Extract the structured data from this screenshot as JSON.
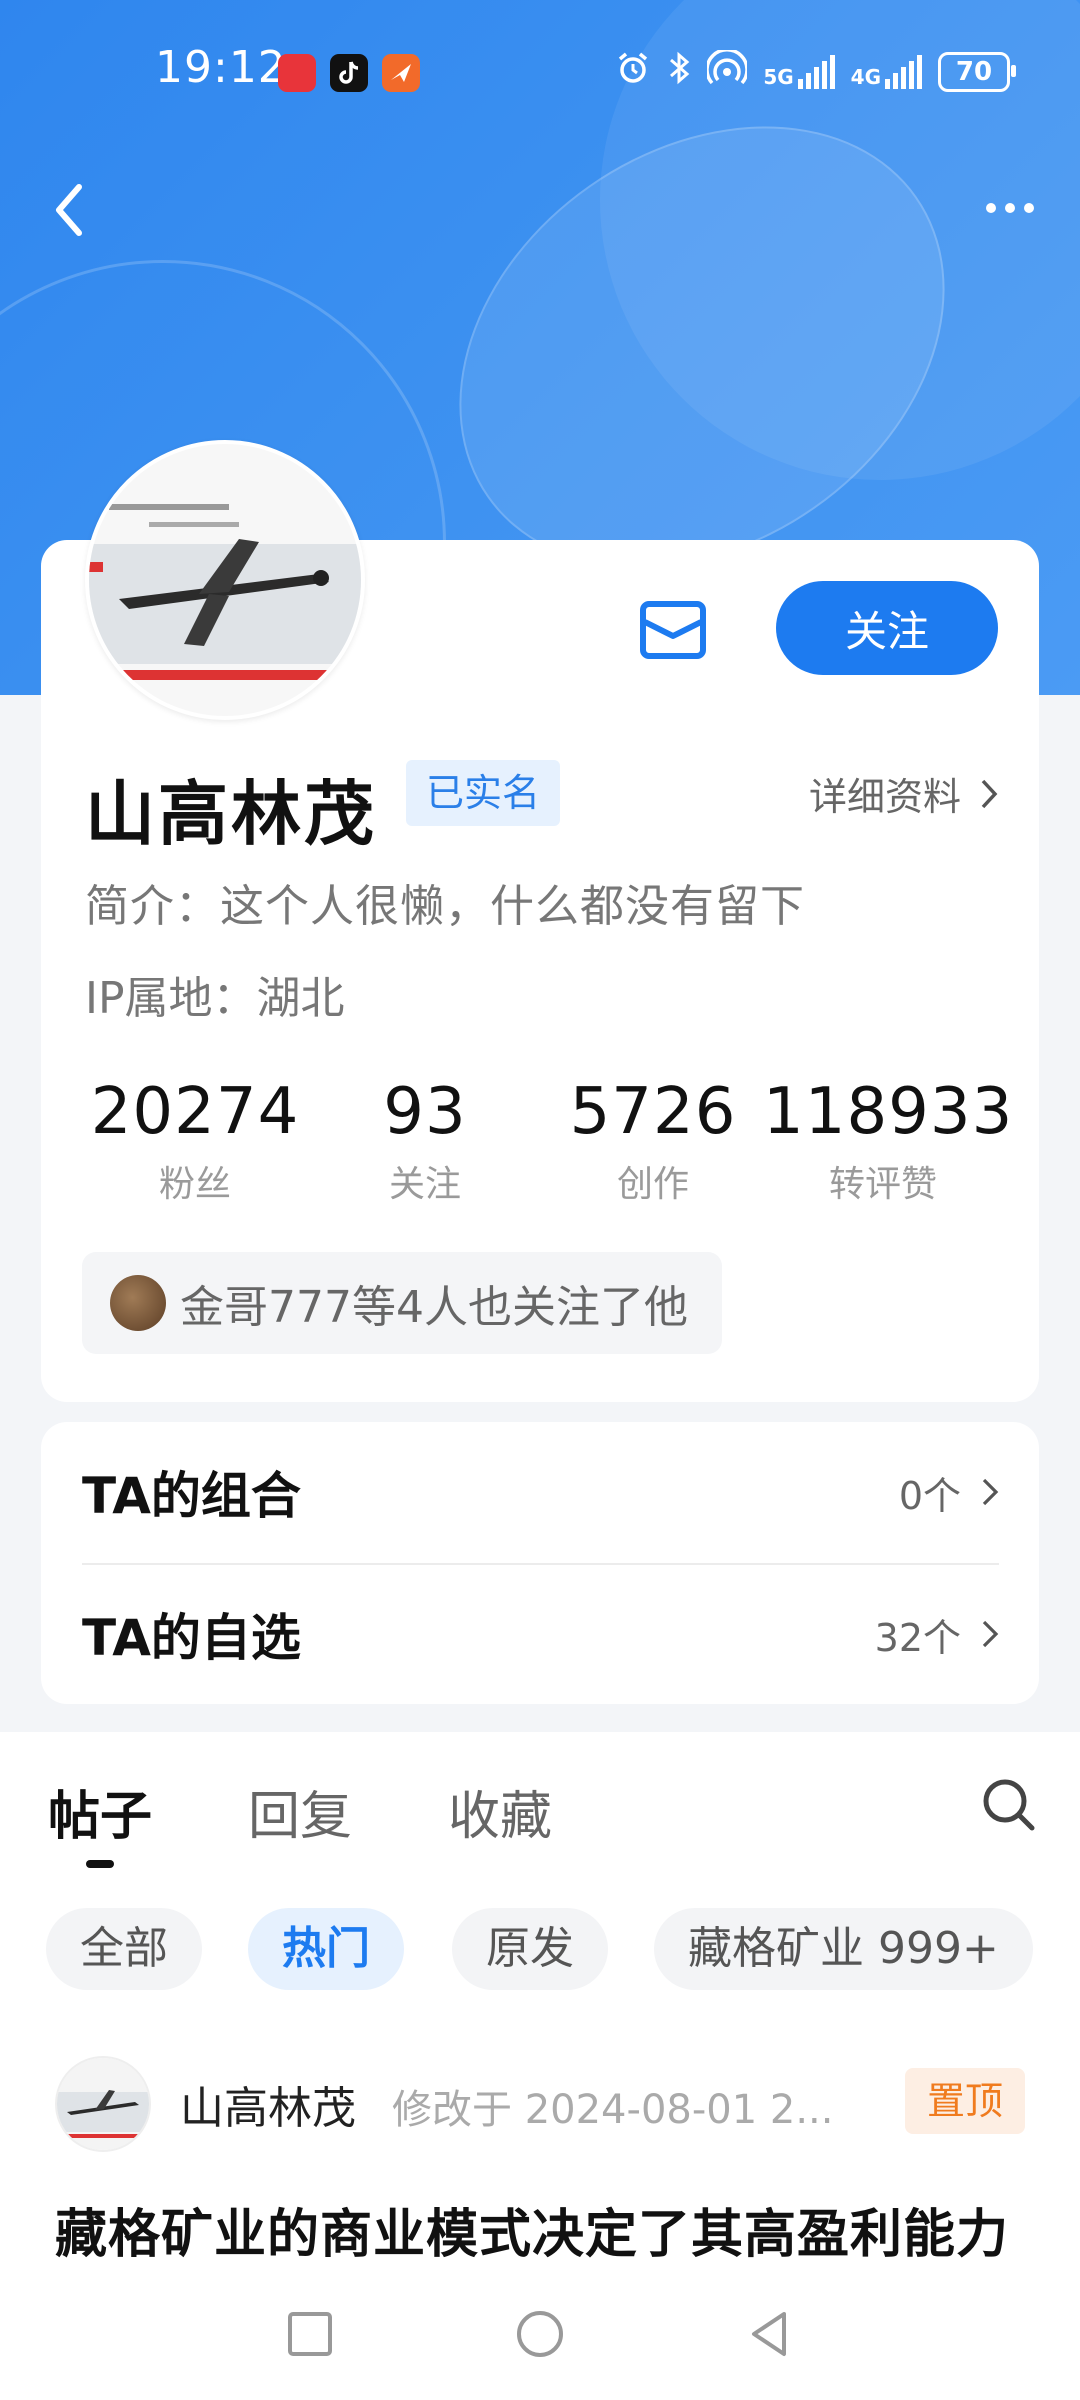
{
  "status_bar": {
    "time": "19:12",
    "network_5g": "5G",
    "network_4g": "4G",
    "battery": "70"
  },
  "profile": {
    "name": "山高林茂",
    "verified_label": "已实名",
    "detail_link": "详细资料",
    "bio": "简介：这个人很懒，什么都没有留下",
    "ip": "IP属地：湖北",
    "follow_label": "关注",
    "stats": [
      {
        "num": "20274",
        "label": "粉丝"
      },
      {
        "num": "93",
        "label": "关注"
      },
      {
        "num": "5726",
        "label": "创作"
      },
      {
        "num": "118933",
        "label": "转评赞"
      }
    ],
    "mutual_text": "金哥777等4人也关注了他"
  },
  "lists": [
    {
      "label": "TA的组合",
      "count": "0个"
    },
    {
      "label": "TA的自选",
      "count": "32个"
    }
  ],
  "tabs": [
    "帖子",
    "回复",
    "收藏"
  ],
  "active_tab": "帖子",
  "filters": [
    "全部",
    "热门",
    "原发",
    "藏格矿业 999+"
  ],
  "active_filter": "热门",
  "post": {
    "author": "山高林茂",
    "time": "修改于 2024-08-01 2...",
    "pin": "置顶",
    "title": "藏格矿业的商业模式决定了其高盈利能力"
  },
  "colors": {
    "accent": "#1d7bf0",
    "header_bg": "#3a8ff0",
    "pin": "#f07b1e"
  }
}
